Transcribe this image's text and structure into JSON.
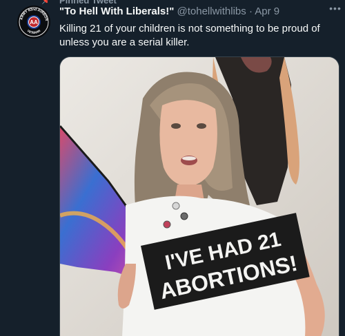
{
  "context": {
    "label": "Pinned Tweet"
  },
  "author": {
    "name": "\"To Hell With Liberals!\"",
    "handle": "@tohellwithlibs",
    "date": "Apr 9",
    "avatar_text": {
      "top": "US ARMY 82nd AIRBORNE",
      "bottom": "VETERAN",
      "badge": "AA"
    }
  },
  "tweet": {
    "text": "Killing 21 of your children is not something to be proud of unless you are a serial killer."
  },
  "media": {
    "shirt_line1": "I'VE HAD 21",
    "shirt_line2": "ABORTIONS!"
  },
  "icons": {
    "more": "more-icon",
    "pin": "pin-icon"
  },
  "colors": {
    "background": "#15202b",
    "secondary_text": "#8b98a5",
    "primary_text": "#f7f9f9"
  }
}
